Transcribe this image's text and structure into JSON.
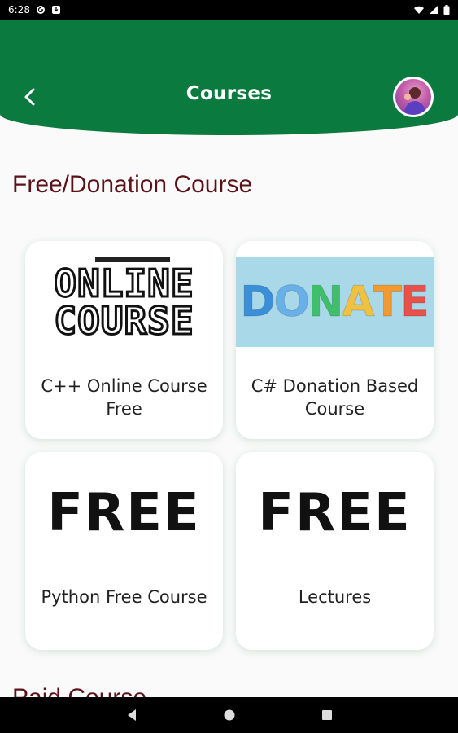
{
  "status_bar": {
    "time": "6:28",
    "icons": [
      "circle-g-icon",
      "download-icon",
      "wifi-icon",
      "signal-icon",
      "battery-icon"
    ]
  },
  "header": {
    "title": "Courses",
    "back_icon": "chevron-left-icon",
    "avatar": "user-avatar"
  },
  "section": {
    "title": "Free/Donation Course",
    "next_title": "Paid Course"
  },
  "courses": [
    {
      "label": "C++ Online Course Free",
      "image_text": [
        "ONLINE",
        "COURSE"
      ]
    },
    {
      "label": "C# Donation Based Course",
      "image_text": "DONATE"
    },
    {
      "label": "Python Free Course",
      "image_text": "FREE"
    },
    {
      "label": "Lectures",
      "image_text": "FREE"
    }
  ],
  "colors": {
    "header_green": "#0b7a3e",
    "section_title": "#5a1218"
  },
  "nav_bar": {
    "icons": [
      "back-triangle-icon",
      "home-circle-icon",
      "recents-square-icon"
    ]
  }
}
